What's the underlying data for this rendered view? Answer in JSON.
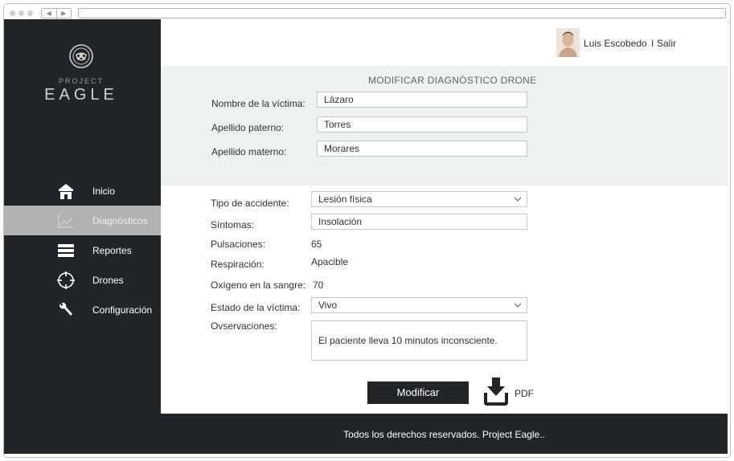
{
  "brand": {
    "logo_small": "PROJECT",
    "logo_big": "EAGLE"
  },
  "sidebar": {
    "items": [
      {
        "label": "Inicio",
        "icon": "home-icon",
        "active": false
      },
      {
        "label": "Diagnósticos",
        "icon": "line-chart-icon",
        "active": true
      },
      {
        "label": "Reportes",
        "icon": "menu-bars-icon",
        "active": false
      },
      {
        "label": "Drones",
        "icon": "crosshair-icon",
        "active": false
      },
      {
        "label": "Configuración",
        "icon": "wrench-icon",
        "active": false
      }
    ]
  },
  "header": {
    "user_name": "Luis Escobedo",
    "separator": "I",
    "logout_label": "Salir"
  },
  "victim": {
    "title": "MODIFICAR DIAGNÓSTICO DRONE",
    "name_label": "Nombre de la víctima:",
    "name_value": "Lázaro",
    "paternal_label": "Apellido paterno:",
    "paternal_value": "Torres",
    "maternal_label": "Apellido materno:",
    "maternal_value": "Morares"
  },
  "diagnosis": {
    "accident_label": "Tipo de accidente:",
    "accident_value": "Lesión física",
    "symptoms_label": "Síntomas:",
    "symptoms_value": "Insolación",
    "pulse_label": "Pulsaciones:",
    "pulse_value": "65",
    "breathing_label": "Respiración:",
    "breathing_value": "Apacible",
    "oxygen_label": "Oxígeno en la sangre:",
    "oxygen_value": "70",
    "status_label": "Estado de la víctima:",
    "status_value": "Vivo",
    "notes_label": "Ovservaciones:",
    "notes_value": "El paciente lleva 10 minutos inconsciente."
  },
  "actions": {
    "modify_label": "Modificar",
    "pdf_label": "PDF"
  },
  "footer": {
    "text": "Todos los derechos reservados. Project Eagle.."
  },
  "colors": {
    "sidebar_bg": "#222527",
    "active_item_bg": "#b2b2b2",
    "panel_bg": "#edf2f1"
  }
}
